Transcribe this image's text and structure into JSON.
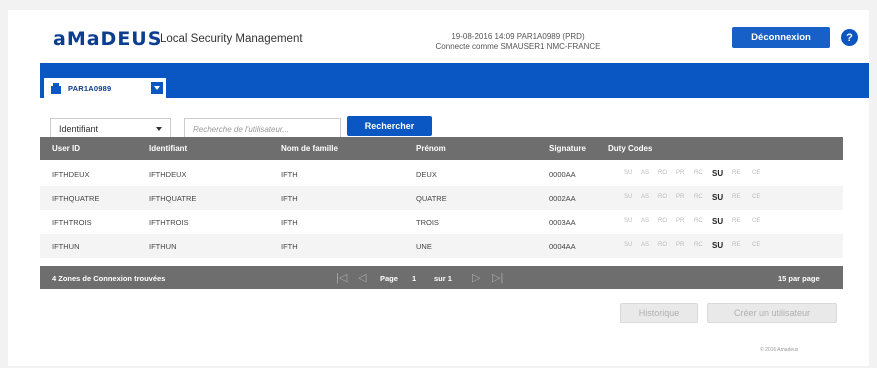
{
  "header": {
    "logo": "aMaDEUS",
    "app_title": "Local Security Management",
    "session_line1": "19-08-2016 14:09  PAR1A0989 (PRD)",
    "session_line2": "Connecte comme SMAUSER1 NMC-FRANCE",
    "logout_label": "Déconnexion",
    "help_label": "?"
  },
  "office_tab": {
    "label": "PAR1A0989"
  },
  "search": {
    "field_select": "Identifiant",
    "placeholder": "Recherche de l'utilisateur...",
    "button_label": "Rechercher"
  },
  "table": {
    "columns": [
      "User ID",
      "Identifiant",
      "Nom de famille",
      "Prénom",
      "Signature",
      "Duty Codes"
    ],
    "rows": [
      {
        "user_id": "IFTHDEUX",
        "identifiant": "IFTHDEUX",
        "nom": "IFTH",
        "prenom": "DEUX",
        "signature": "0000AA"
      },
      {
        "user_id": "IFTHQUATRE",
        "identifiant": "IFTHQUATRE",
        "nom": "IFTH",
        "prenom": "QUATRE",
        "signature": "0002AA"
      },
      {
        "user_id": "IFTHTROIS",
        "identifiant": "IFTHTROIS",
        "nom": "IFTH",
        "prenom": "TROIS",
        "signature": "0003AA"
      },
      {
        "user_id": "IFTHUN",
        "identifiant": "IFTHUN",
        "nom": "IFTH",
        "prenom": "UNE",
        "signature": "0004AA"
      }
    ],
    "duty_codes": [
      "SU",
      "AS",
      "RO",
      "PR",
      "RC",
      "SU",
      "RE",
      "CE"
    ]
  },
  "pager": {
    "count_label": "4  Zones de Connexion trouvées",
    "first": "|◁",
    "prev": "◁",
    "page_label": "Page",
    "page_value": "1",
    "of_label": "sur 1",
    "next": "▷",
    "last": "▷|",
    "per_page": "15 par page"
  },
  "actions": {
    "history_label": "Historique",
    "create_user_label": "Créer un utilisateur"
  },
  "footer": {
    "text": "© 2016 Amadeus"
  }
}
